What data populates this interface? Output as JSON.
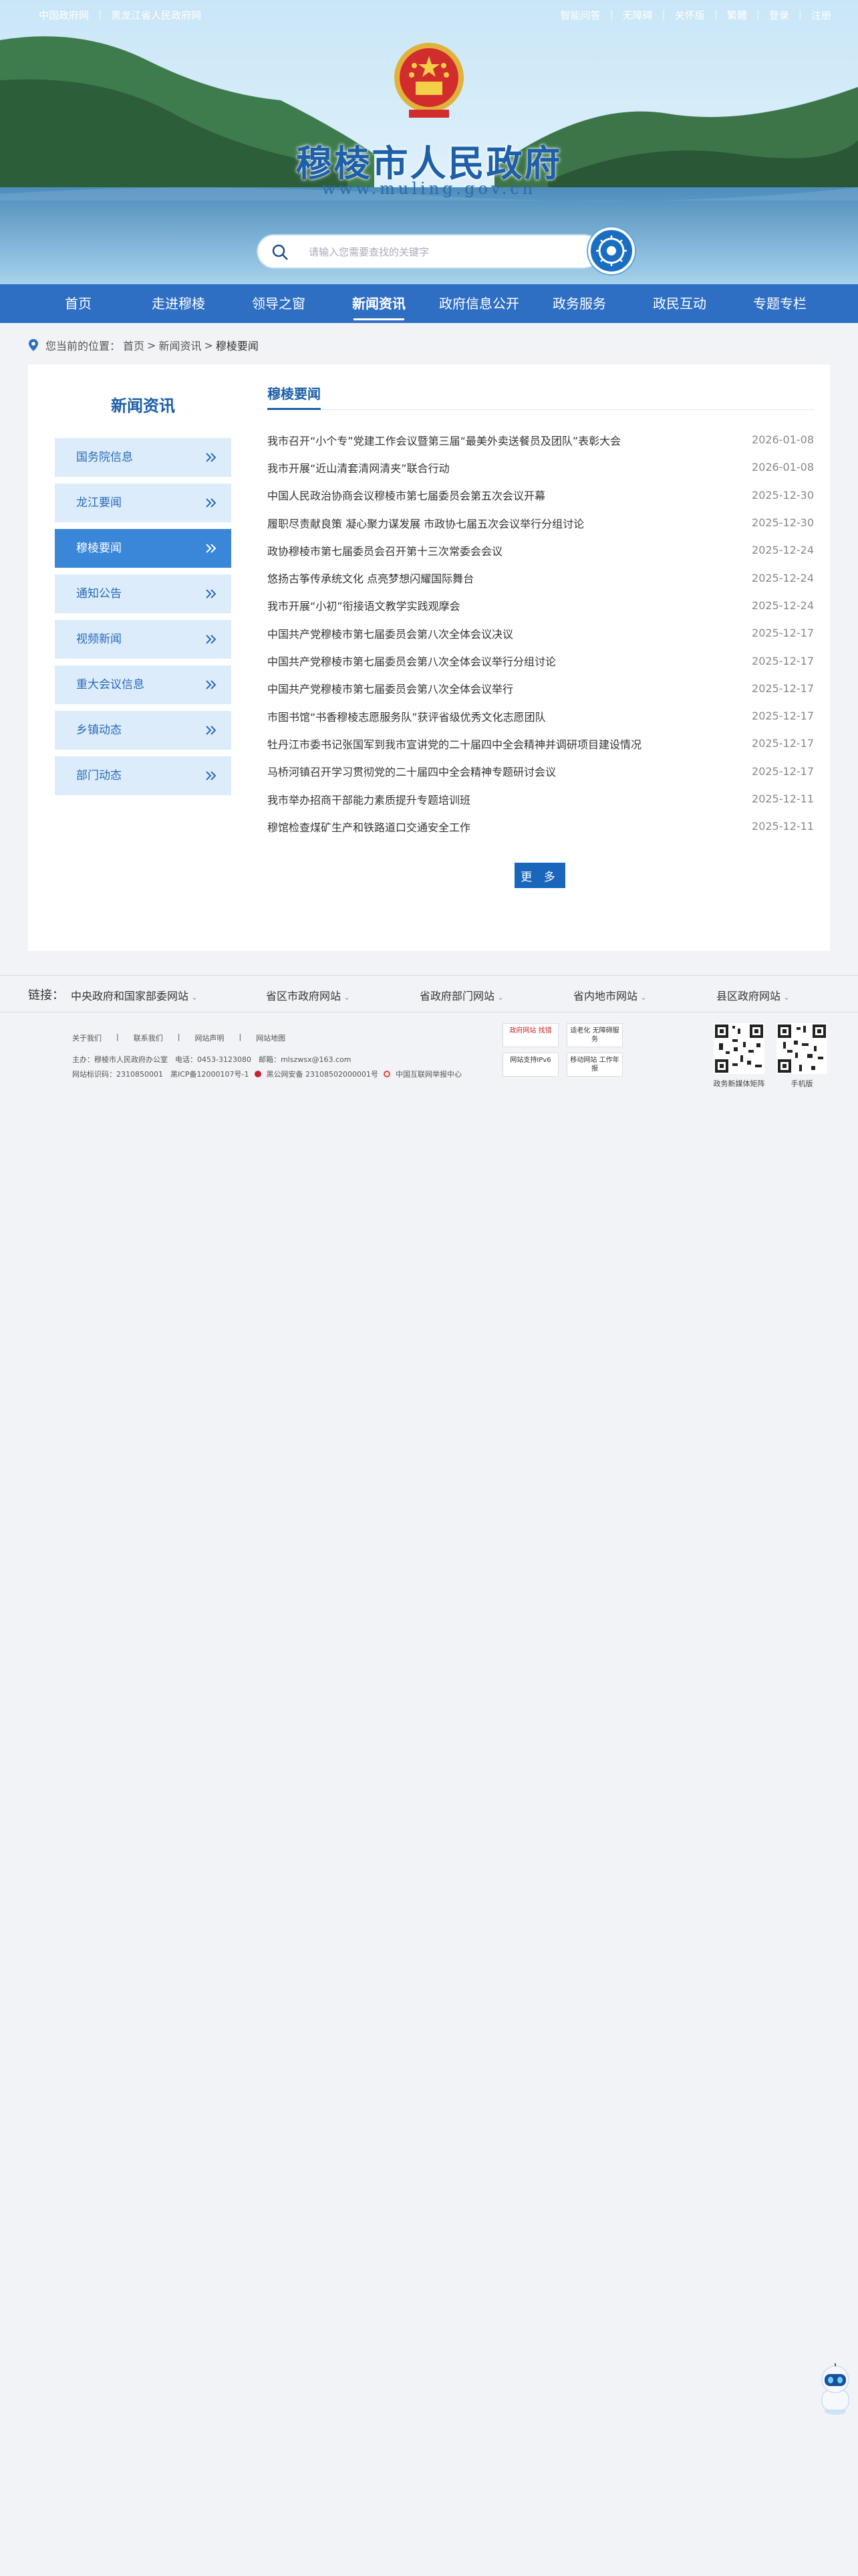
{
  "topbar": {
    "left": [
      "中国政府网",
      "黑龙江省人民政府网"
    ],
    "right": [
      "智能问答",
      "无障碍",
      "关怀版",
      "繁體",
      "登录",
      "注册"
    ]
  },
  "site": {
    "title": "穆棱市人民政府",
    "url": "www.muling.gov.cn"
  },
  "search": {
    "placeholder": "请输入您需要查找的关键字"
  },
  "nav": [
    "首页",
    "走进穆棱",
    "领导之窗",
    "新闻资讯",
    "政府信息公开",
    "政务服务",
    "政民互动",
    "专题专栏"
  ],
  "breadcrumb": {
    "label": "您当前的位置：",
    "items": [
      "首页",
      ">",
      "新闻资讯",
      ">",
      "穆棱要闻"
    ]
  },
  "sidebar": {
    "title": "新闻资讯",
    "items": [
      {
        "label": "国务院信息"
      },
      {
        "label": "龙江要闻"
      },
      {
        "label": "穆棱要闻",
        "active": true
      },
      {
        "label": "通知公告"
      },
      {
        "label": "视频新闻"
      },
      {
        "label": "重大会议信息"
      },
      {
        "label": "乡镇动态"
      },
      {
        "label": "部门动态"
      }
    ]
  },
  "content": {
    "heading": "穆棱要闻",
    "news": [
      {
        "title": "我市召开“小个专”党建工作会议暨第三届“最美外卖送餐员及团队”表彰大会",
        "date": "2026-01-08"
      },
      {
        "title": "我市开展“近山清套清网清夹”联合行动",
        "date": "2026-01-08"
      },
      {
        "title": "中国人民政治协商会议穆棱市第七届委员会第五次会议开幕",
        "date": "2025-12-30"
      },
      {
        "title": "履职尽责献良策 凝心聚力谋发展 市政协七届五次会议举行分组讨论",
        "date": "2025-12-30"
      },
      {
        "title": "政协穆棱市第七届委员会召开第十三次常委会会议",
        "date": "2025-12-24"
      },
      {
        "title": "悠扬古筝传承统文化 点亮梦想闪耀国际舞台",
        "date": "2025-12-24"
      },
      {
        "title": "我市开展“小初”衔接语文教学实践观摩会",
        "date": "2025-12-24"
      },
      {
        "title": "中国共产党穆棱市第七届委员会第八次全体会议决议",
        "date": "2025-12-17"
      },
      {
        "title": "中国共产党穆棱市第七届委员会第八次全体会议举行分组讨论",
        "date": "2025-12-17"
      },
      {
        "title": "中国共产党穆棱市第七届委员会第八次全体会议举行",
        "date": "2025-12-17"
      },
      {
        "title": "市图书馆“书香穆棱志愿服务队”获评省级优秀文化志愿团队",
        "date": "2025-12-17"
      },
      {
        "title": "牡丹江市委书记张国军到我市宣讲党的二十届四中全会精神并调研项目建设情况",
        "date": "2025-12-17"
      },
      {
        "title": "马桥河镇召开学习贯彻党的二十届四中全会精神专题研讨会议",
        "date": "2025-12-17"
      },
      {
        "title": "我市举办招商干部能力素质提升专题培训班",
        "date": "2025-12-11"
      },
      {
        "title": "穆馆检查煤矿生产和铁路道口交通安全工作",
        "date": "2025-12-11"
      }
    ],
    "more": "更 多"
  },
  "links": {
    "label": "链接：",
    "items": [
      "中央政府和国家部委网站",
      "省区市政府网站",
      "省政府部门网站",
      "省内地市网站",
      "县区政府网站"
    ]
  },
  "footer": {
    "links": [
      "关于我们",
      "|",
      "联系我们",
      "|",
      "网站声明",
      "|",
      "网站地图"
    ],
    "line1": "主办：穆棱市人民政府办公室　电话：0453-3123080　邮箱：mlszwsx@163.com",
    "line2_a": "网站标识码：2310850001　黑ICP备12000107号-1",
    "line2_b": "黑公网安备 23108502000001号",
    "line2_c": "中国互联网举报中心",
    "badges": [
      "政府网站 找错",
      "适老化 无障碍服务",
      "网站支持IPv6",
      "移动网站 工作年报"
    ],
    "qr_captions": [
      "政务新媒体矩阵",
      "手机版"
    ]
  },
  "colors": {
    "nav_bg": "#2f6fc3",
    "accent": "#1b5ea8",
    "side_active": "#3a86d8",
    "side_bg": "#dcecfb",
    "more_btn": "#1a66bd"
  }
}
